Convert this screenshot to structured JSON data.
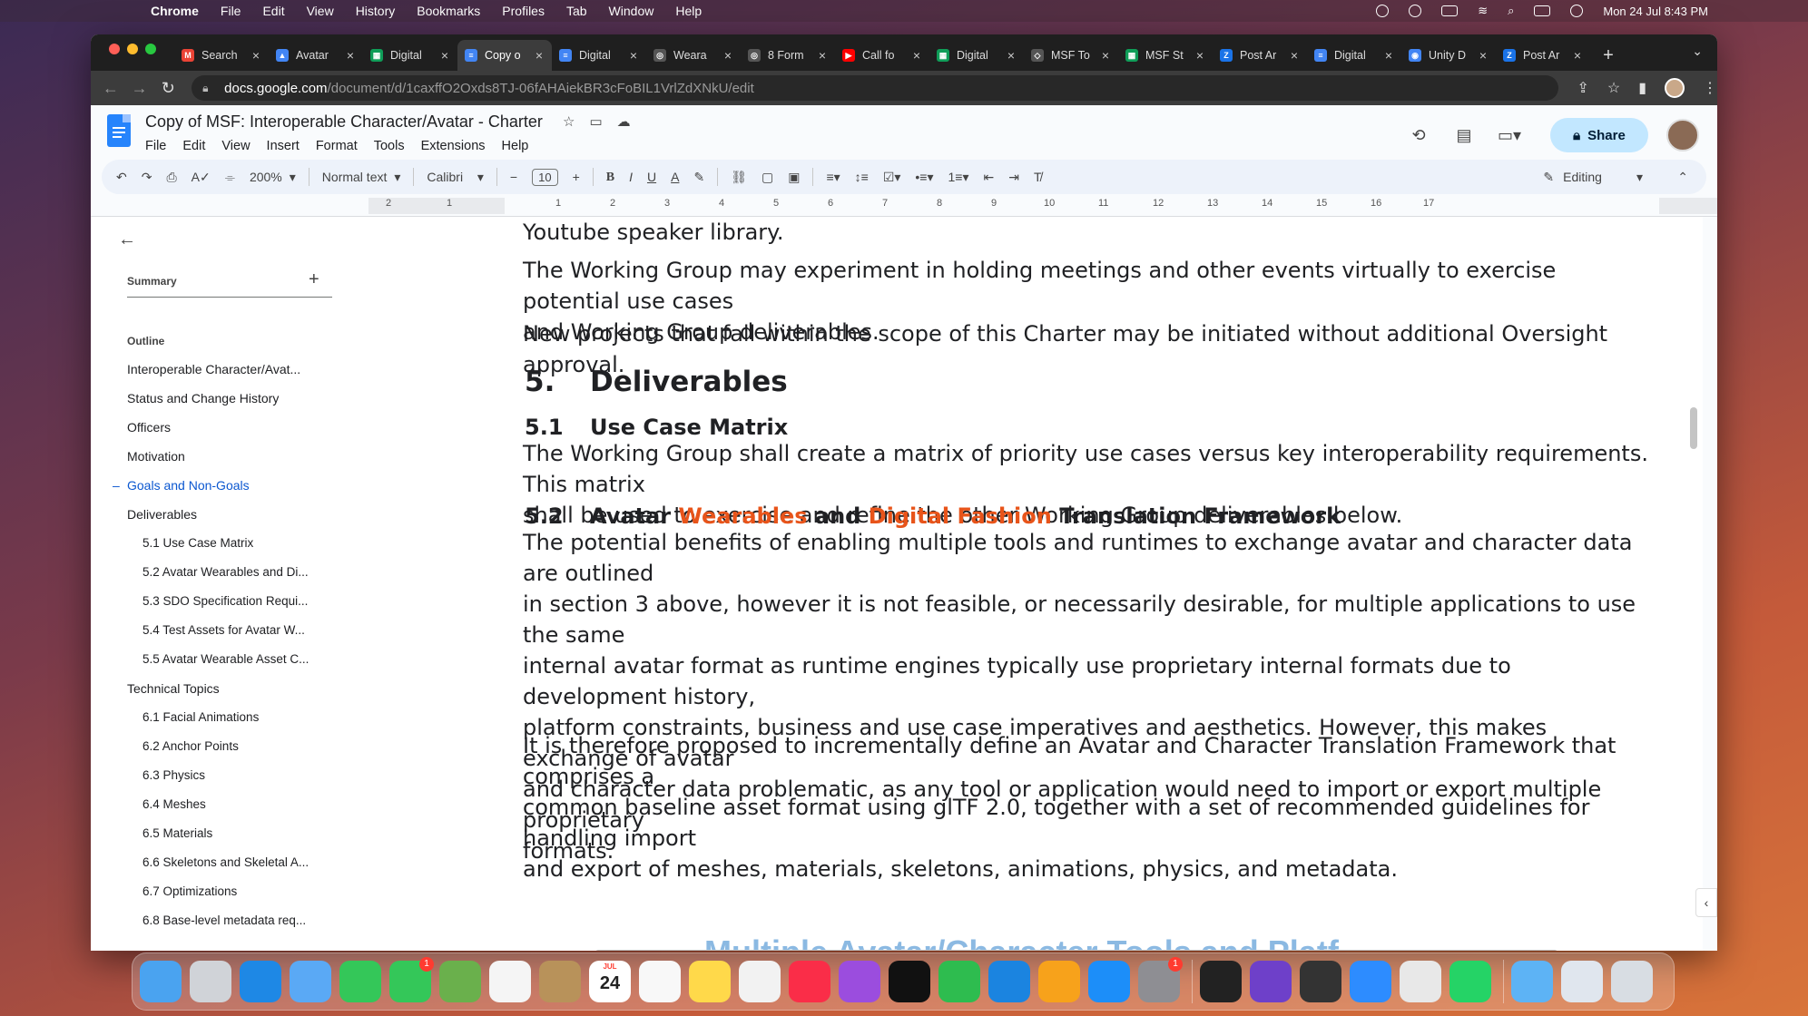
{
  "menubar": {
    "app": "Chrome",
    "items": [
      "File",
      "Edit",
      "View",
      "History",
      "Bookmarks",
      "Profiles",
      "Tab",
      "Window",
      "Help"
    ],
    "clock": "Mon 24 Jul  8:43 PM"
  },
  "tabs": [
    {
      "title": "Search",
      "color": "#ea4335",
      "icon": "gmail-icon",
      "glyph": "M"
    },
    {
      "title": "Avatar",
      "color": "#4285f4",
      "icon": "drive-icon",
      "glyph": "▲"
    },
    {
      "title": "Digital",
      "color": "#0f9d58",
      "icon": "sheets-icon",
      "glyph": "▦"
    },
    {
      "title": "Copy o",
      "color": "#4285f4",
      "icon": "docs-icon",
      "glyph": "≡",
      "active": true
    },
    {
      "title": "Digital",
      "color": "#4285f4",
      "icon": "docs-icon",
      "glyph": "≡"
    },
    {
      "title": "Weara",
      "color": "#555",
      "icon": "globe-icon",
      "glyph": "◎"
    },
    {
      "title": "8 Form",
      "color": "#555",
      "icon": "globe-icon",
      "glyph": "◎"
    },
    {
      "title": "Call fo",
      "color": "#ff0000",
      "icon": "youtube-icon",
      "glyph": "▶"
    },
    {
      "title": "Digital",
      "color": "#0f9d58",
      "icon": "sheets-icon",
      "glyph": "▦"
    },
    {
      "title": "MSF To",
      "color": "#555",
      "icon": "shield-icon",
      "glyph": "◇"
    },
    {
      "title": "MSF St",
      "color": "#0f9d58",
      "icon": "sheets-icon",
      "glyph": "▦"
    },
    {
      "title": "Post Ar",
      "color": "#1a73e8",
      "icon": "z-icon",
      "glyph": "Z"
    },
    {
      "title": "Digital",
      "color": "#4285f4",
      "icon": "docs-icon",
      "glyph": "≡"
    },
    {
      "title": "Unity D",
      "color": "#4285f4",
      "icon": "unity-icon",
      "glyph": "◉"
    },
    {
      "title": "Post Ar",
      "color": "#1a73e8",
      "icon": "z-icon",
      "glyph": "Z"
    }
  ],
  "address": {
    "domain": "docs.google.com",
    "path": "/document/d/1caxffO2Oxds8TJ-06fAHAiekBR3cFoBIL1VrlZdXNkU/edit"
  },
  "docs": {
    "title": "Copy of MSF: Interoperable Character/Avatar - Charter",
    "menu": [
      "File",
      "Edit",
      "View",
      "Insert",
      "Format",
      "Tools",
      "Extensions",
      "Help"
    ],
    "share": "Share"
  },
  "toolbar": {
    "zoom": "200%",
    "style": "Normal text",
    "font": "Calibri",
    "size": "10",
    "mode": "Editing"
  },
  "ruler": [
    "2",
    "1",
    "1",
    "2",
    "3",
    "4",
    "5",
    "6",
    "7",
    "8",
    "9",
    "10",
    "11",
    "12",
    "13",
    "14",
    "15",
    "16",
    "17"
  ],
  "sidebar": {
    "summary": "Summary",
    "outline_label": "Outline",
    "items": [
      {
        "label": "Interoperable Character/Avat...",
        "level": 1
      },
      {
        "label": "Status and Change History",
        "level": 1
      },
      {
        "label": "Officers",
        "level": 1
      },
      {
        "label": "Motivation",
        "level": 1
      },
      {
        "label": "Goals and Non-Goals",
        "level": 1,
        "active": true
      },
      {
        "label": "Deliverables",
        "level": 1
      },
      {
        "label": "5.1 Use Case Matrix",
        "level": 2
      },
      {
        "label": "5.2 Avatar Wearables and Di...",
        "level": 2
      },
      {
        "label": "5.3 SDO Specification Requi...",
        "level": 2
      },
      {
        "label": "5.4 Test Assets for Avatar W...",
        "level": 2
      },
      {
        "label": "5.5 Avatar Wearable Asset C...",
        "level": 2
      },
      {
        "label": "Technical Topics",
        "level": 1
      },
      {
        "label": "6.1 Facial Animations",
        "level": 2
      },
      {
        "label": "6.2 Anchor Points",
        "level": 2
      },
      {
        "label": "6.3 Physics",
        "level": 2
      },
      {
        "label": "6.4 Meshes",
        "level": 2
      },
      {
        "label": "6.5 Materials",
        "level": 2
      },
      {
        "label": "6.6 Skeletons and Skeletal A...",
        "level": 2
      },
      {
        "label": "6.7 Optimizations",
        "level": 2
      },
      {
        "label": "6.8 Base-level metadata req...",
        "level": 2
      }
    ]
  },
  "document": {
    "line0": "Youtube speaker library.",
    "para1": [
      "The Working Group may experiment in holding meetings and other events virtually to exercise potential use cases",
      "and Working Group deliverables."
    ],
    "para2": "New projects that fall within the scope of this Charter may be initiated without additional Oversight approval.",
    "h5": {
      "num": "5.",
      "text": "Deliverables"
    },
    "h51": {
      "num": "5.1",
      "text": "Use Case Matrix"
    },
    "para3": [
      "The Working Group shall create a matrix of priority use cases versus key interoperability requirements. This matrix",
      "shall be used to exercise and refine the other Working Group deliverables below."
    ],
    "h52": {
      "num": "5.2",
      "pre": "Avatar ",
      "hl1": "Wearables",
      "mid": " and ",
      "hl2": "Digital Fashion",
      "post": " Translation Framework"
    },
    "para4": [
      "The potential benefits of enabling multiple tools and runtimes to exchange avatar and character data are outlined",
      "in section 3 above, however it is not feasible, or necessarily desirable, for multiple applications to use the same",
      "internal avatar format as runtime engines typically use proprietary internal formats due to development history,",
      "platform constraints, business and use case imperatives and aesthetics. However, this makes exchange of avatar",
      "and character data problematic, as any tool or application would need to import or export multiple proprietary",
      "formats."
    ],
    "para5": [
      "It is therefore proposed to incrementally define an Avatar and Character Translation Framework that comprises a",
      "common baseline asset format using glTF 2.0, together with a set of recommended guidelines for handling import",
      "and export of meshes, materials, skeletons, animations, physics, and metadata."
    ],
    "cutoff": "Multiple Avatar/Character Tools and Platf"
  },
  "dock": {
    "calendar_month": "JUL",
    "calendar_day": "24",
    "messages_badge": "1",
    "settings_badge": "1",
    "apps": [
      {
        "icon": "finder-icon",
        "color": "#4aa3f0"
      },
      {
        "icon": "launchpad-icon",
        "color": "#d0d3d8"
      },
      {
        "icon": "safari-icon",
        "color": "#1e88e5"
      },
      {
        "icon": "mail-icon",
        "color": "#5aa9f5"
      },
      {
        "icon": "facetime-icon",
        "color": "#34c759"
      },
      {
        "icon": "messages-icon",
        "color": "#34c759"
      },
      {
        "icon": "maps-icon",
        "color": "#6ab04c"
      },
      {
        "icon": "photos-icon",
        "color": "#f5f5f5"
      },
      {
        "icon": "contacts-icon",
        "color": "#b8925a"
      },
      {
        "icon": "calendar-icon",
        "color": "#ffffff"
      },
      {
        "icon": "reminders-icon",
        "color": "#f8f8f8"
      },
      {
        "icon": "notes-icon",
        "color": "#ffd94a"
      },
      {
        "icon": "freeform-icon",
        "color": "#f2f2f2"
      },
      {
        "icon": "music-icon",
        "color": "#fa2d48"
      },
      {
        "icon": "podcasts-icon",
        "color": "#9b4dde"
      },
      {
        "icon": "tv-icon",
        "color": "#111111"
      },
      {
        "icon": "numbers-icon",
        "color": "#2ebc4f"
      },
      {
        "icon": "keynote-icon",
        "color": "#1b84e0"
      },
      {
        "icon": "pages-icon",
        "color": "#f7a21b"
      },
      {
        "icon": "appstore-icon",
        "color": "#1c8ef9"
      },
      {
        "icon": "settings-icon",
        "color": "#8e8e93"
      },
      {
        "icon": "terminal-icon",
        "color": "#222222"
      },
      {
        "icon": "github-icon",
        "color": "#6e40c9"
      },
      {
        "icon": "unity-icon",
        "color": "#333333"
      },
      {
        "icon": "zoom-icon",
        "color": "#2d8cff"
      },
      {
        "icon": "chrome-icon",
        "color": "#e8e8e8"
      },
      {
        "icon": "whatsapp-icon",
        "color": "#25d366"
      },
      {
        "icon": "folder-icon",
        "color": "#5db3f5"
      },
      {
        "icon": "preview-icon",
        "color": "#e0e6ee"
      },
      {
        "icon": "trash-icon",
        "color": "#d8dde3"
      }
    ]
  }
}
